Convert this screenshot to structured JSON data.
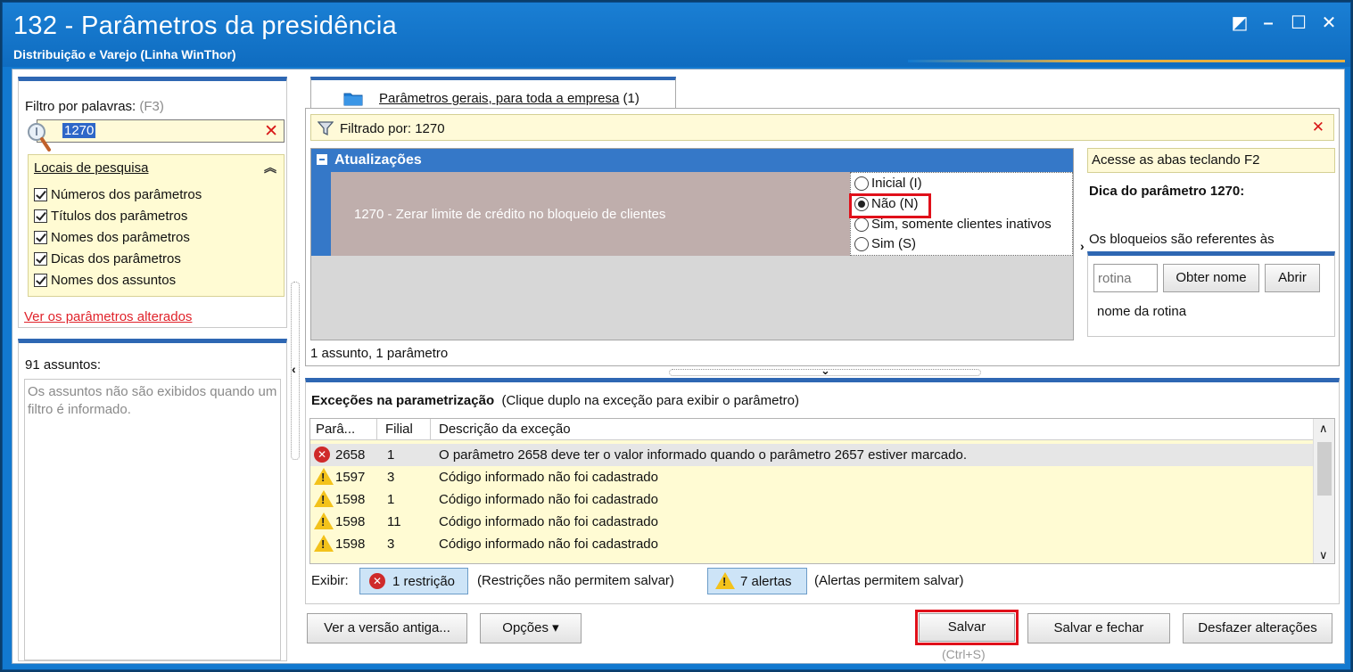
{
  "window": {
    "title": "132 - Parâmetros da presidência",
    "subtitle": "Distribuição e Varejo (Linha WinThor)",
    "controls": {
      "restore": "◩",
      "minimize": "–",
      "maximize": "☐",
      "close": "✕"
    }
  },
  "filter": {
    "label": "Filtro por palavras:",
    "hint": "(F3)",
    "value": "1270",
    "clear_glyph": "✕",
    "locais_title": "Locais de pesquisa",
    "collapse_glyph": "︽",
    "checkboxes": [
      "Números dos parâmetros",
      "Títulos dos parâmetros",
      "Nomes dos parâmetros",
      "Dicas dos parâmetros",
      "Nomes dos assuntos"
    ],
    "changed_link": "Ver os parâmetros alterados"
  },
  "subjects": {
    "count": "91 assuntos:",
    "message": "Os assuntos não são exibidos quando um filtro é informado."
  },
  "splitter_glyphs": {
    "left": "‹",
    "right": "›",
    "down": "⌄"
  },
  "tab": {
    "label": "Parâmetros gerais, para toda a empresa",
    "count": "(1)"
  },
  "filtered": {
    "text": "Filtrado por: 1270",
    "clear_glyph": "✕"
  },
  "group": {
    "title": "Atualizações"
  },
  "parameter": {
    "text": "1270 - Zerar limite de crédito no bloqueio de clientes",
    "options": [
      "Inicial (I)",
      "Não (N)",
      "Sim, somente clientes inativos",
      "Sim (S)"
    ],
    "selected_index": 1
  },
  "summary": "1 assunto, 1 parâmetro",
  "tip": {
    "access_hint": "Acesse as abas teclando F2",
    "title": "Dica do parâmetro 1270:",
    "text": "Os bloqueios são referentes às",
    "rotina_placeholder": "rotina",
    "obter_nome": "Obter nome",
    "abrir": "Abrir",
    "nome_rotina": "nome da rotina"
  },
  "exceptions": {
    "title": "Exceções na parametrização",
    "subtitle": "(Clique duplo na exceção para exibir o parâmetro)",
    "columns": [
      "Parâ...",
      "Filial",
      "Descrição da exceção"
    ],
    "rows": [
      {
        "type": "error",
        "param": "2658",
        "filial": "1",
        "desc": "O parâmetro 2658 deve ter o valor informado quando o parâmetro 2657 estiver marcado."
      },
      {
        "type": "warning",
        "param": "1597",
        "filial": "3",
        "desc": "Código informado não foi cadastrado"
      },
      {
        "type": "warning",
        "param": "1598",
        "filial": "1",
        "desc": "Código informado não foi cadastrado"
      },
      {
        "type": "warning",
        "param": "1598",
        "filial": "11",
        "desc": "Código informado não foi cadastrado"
      },
      {
        "type": "warning",
        "param": "1598",
        "filial": "3",
        "desc": "Código informado não foi cadastrado"
      }
    ],
    "scroll_up": "∧",
    "scroll_down": "∨",
    "exibir": "Exibir:",
    "restricoes_btn": "1 restrição",
    "restricoes_note": "(Restrições não permitem salvar)",
    "alertas_btn": "7 alertas",
    "alertas_note": "(Alertas permitem salvar)"
  },
  "buttons": {
    "versao": "Ver a versão antiga...",
    "opcoes": "Opções ▾",
    "salvar": "Salvar",
    "salvar_fechar": "Salvar e fechar",
    "desfazer": "Desfazer alterações",
    "salvar_shortcut": "(Ctrl+S)"
  },
  "colors": {
    "title_blue": "#1279d0",
    "panel_accent": "#2e67b3",
    "highlight_red": "#e0101a",
    "yellow_bg": "#fffad8"
  }
}
